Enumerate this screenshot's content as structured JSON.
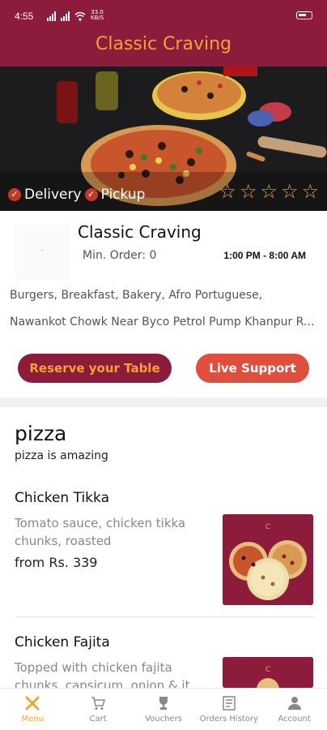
{
  "status_bar": {
    "time": "4:55",
    "speed_top": "33.0",
    "speed_bottom": "KB/S"
  },
  "header": {
    "title": "Classic Craving"
  },
  "hero": {
    "badges": [
      {
        "label": "Delivery"
      },
      {
        "label": "Pickup"
      }
    ],
    "rating_stars": 5,
    "rating_filled": 0
  },
  "restaurant": {
    "name": "Classic Craving",
    "min_order": "Min. Order: 0",
    "hours": "1:00 PM - 8:00 AM",
    "cuisines": "Burgers, Breakfast, Bakery, Afro Portuguese,",
    "address": "Nawankot Chowk Near Byco Petrol Pump Khanpur Road",
    "reserve_label": "Reserve your Table",
    "support_label": "Live Support"
  },
  "category": {
    "title": "pizza",
    "description": "pizza is amazing"
  },
  "items": [
    {
      "name": "Chicken Tikka",
      "description": "Tomato sauce, chicken tikka chunks, roasted",
      "price": "from Rs. 339"
    },
    {
      "name": "Chicken Fajita",
      "description": "Topped with chicken fajita chunks, capsicum, onion & it"
    }
  ],
  "bottom_nav": [
    {
      "label": "Menu",
      "icon": "fork-knife-icon",
      "active": true
    },
    {
      "label": "Cart",
      "icon": "cart-icon",
      "active": false
    },
    {
      "label": "Vouchers",
      "icon": "trophy-icon",
      "active": false
    },
    {
      "label": "Orders History",
      "icon": "receipt-icon",
      "active": false
    },
    {
      "label": "Account",
      "icon": "person-icon",
      "active": false
    }
  ],
  "colors": {
    "brand": "#8d1c3c",
    "accent": "#f5a233",
    "support": "#e04e3e"
  }
}
